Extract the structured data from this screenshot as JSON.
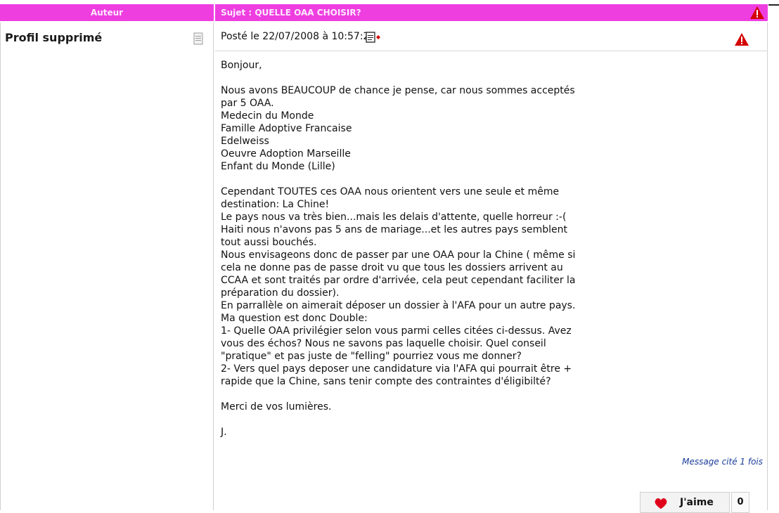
{
  "header": {
    "author_label": "Auteur",
    "subject_label": "Sujet : QUELLE OAA CHOISIR?"
  },
  "author": {
    "name": "Profil supprimé",
    "profile_icon": "document-icon"
  },
  "post": {
    "posted": "Posté le 22/07/2008 à 10:57:22",
    "quote_icon": "quote-icon",
    "message_lines": [
      "Bonjour,",
      "",
      "Nous avons BEAUCOUP de chance je pense, car nous sommes acceptés",
      "par 5 OAA.",
      "Medecin du Monde",
      "Famille Adoptive Francaise",
      "Edelweiss",
      "Oeuvre Adoption Marseille",
      "Enfant du Monde (Lille)",
      "",
      "Cependant TOUTES ces OAA nous orientent vers une seule et même",
      "destination: La Chine!",
      "Le pays nous va très bien...mais les delais d'attente, quelle horreur :-(",
      "Haiti nous n'avons pas 5 ans de mariage...et les autres pays semblent",
      "tout aussi bouchés.",
      "Nous envisageons donc de passer par une OAA pour la Chine ( même si",
      "cela ne donne pas de passe droit vu que tous les dossiers arrivent au",
      "CCAA et sont traités par ordre d'arrivée, cela peut cependant faciliter la",
      "préparation du dossier).",
      "En parrallèle on aimerait déposer un dossier à l'AFA pour un autre pays.",
      "Ma question est donc Double:",
      "1- Quelle OAA privilégier selon vous parmi celles citées ci-dessus. Avez",
      "vous des échos? Nous ne savons pas laquelle choisir. Quel conseil",
      "\"pratique\" et pas juste de \"felling\" pourriez vous me donner?",
      "2- Vers quel pays deposer une candidature via l'AFA qui pourrait être +",
      "rapide que la Chine, sans tenir compte des contraintes d'éligibilté?",
      "",
      "Merci de vos lumières.",
      "",
      "J."
    ],
    "cited": "Message cité 1 fois",
    "like_label": "J'aime",
    "like_count": "0"
  },
  "icons": {
    "warning": "warning-icon",
    "heart": "heart-icon"
  },
  "colors": {
    "header_bg": "#ee3ee0",
    "warning_red": "#d40000",
    "heart_red": "#e0001b",
    "link_blue": "#1a3b9a"
  }
}
